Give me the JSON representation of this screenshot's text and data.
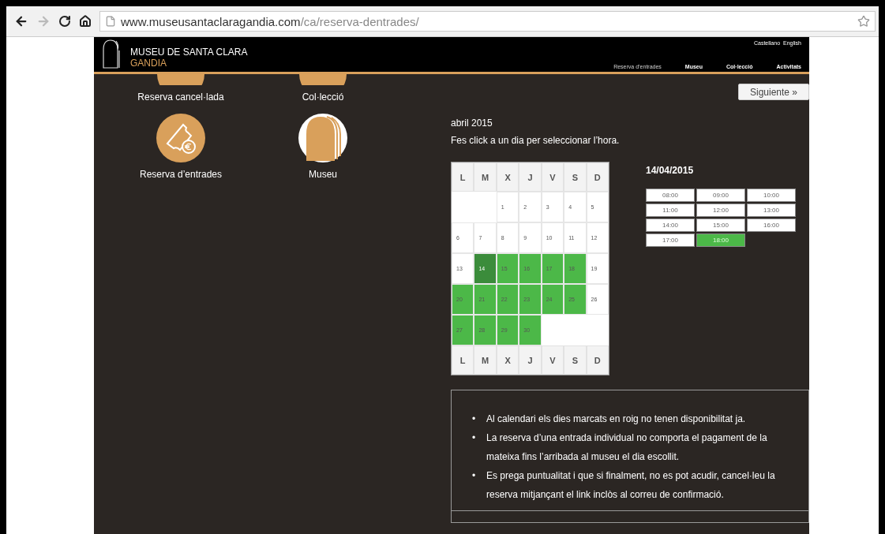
{
  "browser": {
    "url_host": "www.museusantaclaragandia.com",
    "url_path": "/ca/reserva-dentrades/"
  },
  "header": {
    "logo_title": "MUSEU DE SANTA CLARA",
    "logo_subtitle": "GANDIA",
    "languages": [
      "Castellano",
      "English"
    ],
    "nav": [
      {
        "label": "Reserva d’entrades",
        "selected": true
      },
      {
        "label": "Museu",
        "selected": false
      },
      {
        "label": "Col·lecció",
        "selected": false
      },
      {
        "label": "Activitats",
        "selected": false
      }
    ]
  },
  "shortcuts": [
    {
      "label": "Reserva cancel·lada",
      "kind": "cropped"
    },
    {
      "label": "Col·lecció",
      "kind": "cropped"
    },
    {
      "label": "Reserva d’entrades",
      "kind": "ticket"
    },
    {
      "label": "Museu",
      "kind": "arch"
    }
  ],
  "next_button": "Siguiente »",
  "calendar": {
    "month": "abril 2015",
    "hint": "Fes click a un dia per seleccionar l’hora.",
    "weekdays": [
      "L",
      "M",
      "X",
      "J",
      "V",
      "S",
      "D"
    ],
    "weeks": [
      [
        {
          "kind": "blank"
        },
        {
          "kind": "blank"
        },
        {
          "kind": "day",
          "day": "1",
          "available": false,
          "selected": false
        },
        {
          "kind": "day",
          "day": "2",
          "available": false,
          "selected": false
        },
        {
          "kind": "day",
          "day": "3",
          "available": false,
          "selected": false
        },
        {
          "kind": "day",
          "day": "4",
          "available": false,
          "selected": false
        },
        {
          "kind": "day",
          "day": "5",
          "available": false,
          "selected": false
        }
      ],
      [
        {
          "kind": "day",
          "day": "6",
          "available": false,
          "selected": false
        },
        {
          "kind": "day",
          "day": "7",
          "available": false,
          "selected": false
        },
        {
          "kind": "day",
          "day": "8",
          "available": false,
          "selected": false
        },
        {
          "kind": "day",
          "day": "9",
          "available": false,
          "selected": false
        },
        {
          "kind": "day",
          "day": "10",
          "available": false,
          "selected": false
        },
        {
          "kind": "day",
          "day": "11",
          "available": false,
          "selected": false
        },
        {
          "kind": "day",
          "day": "12",
          "available": false,
          "selected": false
        }
      ],
      [
        {
          "kind": "day",
          "day": "13",
          "available": false,
          "selected": false
        },
        {
          "kind": "day",
          "day": "14",
          "available": true,
          "selected": true
        },
        {
          "kind": "day",
          "day": "15",
          "available": true,
          "selected": false
        },
        {
          "kind": "day",
          "day": "16",
          "available": true,
          "selected": false
        },
        {
          "kind": "day",
          "day": "17",
          "available": true,
          "selected": false
        },
        {
          "kind": "day",
          "day": "18",
          "available": true,
          "selected": false
        },
        {
          "kind": "day",
          "day": "19",
          "available": false,
          "selected": false
        }
      ],
      [
        {
          "kind": "day",
          "day": "20",
          "available": true,
          "selected": false
        },
        {
          "kind": "day",
          "day": "21",
          "available": true,
          "selected": false
        },
        {
          "kind": "day",
          "day": "22",
          "available": true,
          "selected": false
        },
        {
          "kind": "day",
          "day": "23",
          "available": true,
          "selected": false
        },
        {
          "kind": "day",
          "day": "24",
          "available": true,
          "selected": false
        },
        {
          "kind": "day",
          "day": "25",
          "available": true,
          "selected": false
        },
        {
          "kind": "day",
          "day": "26",
          "available": false,
          "selected": false
        }
      ],
      [
        {
          "kind": "day",
          "day": "27",
          "available": true,
          "selected": false
        },
        {
          "kind": "day",
          "day": "28",
          "available": true,
          "selected": false
        },
        {
          "kind": "day",
          "day": "29",
          "available": true,
          "selected": false
        },
        {
          "kind": "day",
          "day": "30",
          "available": true,
          "selected": false
        },
        {
          "kind": "blank"
        },
        {
          "kind": "blank"
        },
        {
          "kind": "blank"
        }
      ]
    ],
    "weekdays_footer": [
      "L",
      "M",
      "X",
      "J",
      "V",
      "S",
      "D"
    ]
  },
  "time_slots": {
    "date": "14/04/2015",
    "slots": [
      {
        "time": "08:00",
        "selected": false
      },
      {
        "time": "09:00",
        "selected": false
      },
      {
        "time": "10:00",
        "selected": false
      },
      {
        "time": "11:00",
        "selected": false
      },
      {
        "time": "12:00",
        "selected": false
      },
      {
        "time": "13:00",
        "selected": false
      },
      {
        "time": "14:00",
        "selected": false
      },
      {
        "time": "15:00",
        "selected": false
      },
      {
        "time": "16:00",
        "selected": false
      },
      {
        "time": "17:00",
        "selected": false
      },
      {
        "time": "18:00",
        "selected": true
      }
    ]
  },
  "notes": [
    {
      "bullet": "•",
      "text": "Al calendari els dies marcats en roig no tenen disponibilitat ja."
    },
    {
      "bullet": "•",
      "text": "La reserva d’una entrada individual no comporta el pagament de la mateixa fins l’arribada al museu el dia escollit."
    },
    {
      "bullet": "•",
      "text": "Es prega puntualitat i que si finalment, no es pot acudir, cancel·leu la reserva mitjançant el link inclòs al correu de confirmació."
    }
  ]
}
